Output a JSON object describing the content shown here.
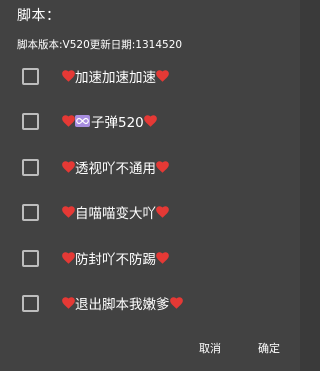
{
  "dialog": {
    "title": "脚本：",
    "subtitle": "脚本版本:V520更新日期:1314520",
    "options": [
      {
        "segments": [
          {
            "type": "heart"
          },
          {
            "type": "text",
            "value": "加速加速加速"
          },
          {
            "type": "heart"
          }
        ],
        "checked": false
      },
      {
        "segments": [
          {
            "type": "heart"
          },
          {
            "type": "infinity"
          },
          {
            "type": "text",
            "value": "子弹520"
          },
          {
            "type": "heart"
          }
        ],
        "checked": false
      },
      {
        "segments": [
          {
            "type": "heart"
          },
          {
            "type": "text",
            "value": "透视吖不通用"
          },
          {
            "type": "heart"
          }
        ],
        "checked": false
      },
      {
        "segments": [
          {
            "type": "heart"
          },
          {
            "type": "text",
            "value": "自喵喵变大吖"
          },
          {
            "type": "heart"
          }
        ],
        "checked": false
      },
      {
        "segments": [
          {
            "type": "heart"
          },
          {
            "type": "text",
            "value": "防封吖不防踢"
          },
          {
            "type": "heart"
          }
        ],
        "checked": false
      },
      {
        "segments": [
          {
            "type": "heart"
          },
          {
            "type": "text",
            "value": "退出脚本我嫩爹"
          },
          {
            "type": "heart"
          }
        ],
        "checked": false
      }
    ],
    "cancel_label": "取消",
    "ok_label": "确定"
  },
  "colors": {
    "background": "#424242",
    "heart": "#e53935",
    "infinity_badge": "#a88ee0",
    "checkbox_border": "#bdbdbd",
    "text": "#ffffff"
  },
  "icons": {
    "heart": "heart-icon",
    "infinity": "infinity-icon",
    "checkbox": "checkbox-icon"
  }
}
